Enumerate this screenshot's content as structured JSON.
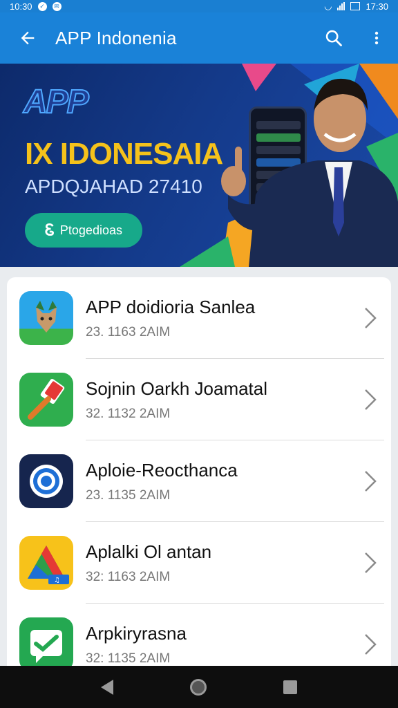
{
  "status_bar": {
    "time_left": "10:30",
    "time_right": "17:30"
  },
  "app_bar": {
    "title": "APP Indonenia",
    "back_icon": "arrow-left-icon",
    "search_icon": "search-icon",
    "menu_icon": "more-vert-icon"
  },
  "banner": {
    "logo": "APP",
    "headline": "IX IDONESAIA",
    "subline": "APDQJAHAD 27410",
    "cta_label": "Ptogedioas"
  },
  "apps": [
    {
      "title": "APP doidioria Sanlea",
      "subtitle": "23. 1163 2AIM",
      "icon": "fox-icon"
    },
    {
      "title": "Sojnin Oarkh Joamatal",
      "subtitle": "32. 1132 2AIM",
      "icon": "brush-icon"
    },
    {
      "title": "Aploie-Reocthanca",
      "subtitle": "23. 1135 2AIM",
      "icon": "target-icon"
    },
    {
      "title": "Aplalki Ol antan",
      "subtitle": "32: 1163 2AIM",
      "icon": "triangle-icon"
    },
    {
      "title": "Arpkiryrasna",
      "subtitle": "32: 1135 2AIM",
      "icon": "chat-check-icon"
    }
  ],
  "colors": {
    "app_bar": "#1a82d8",
    "banner_bg": "#143a8a",
    "headline": "#f5c21b",
    "cta": "#17a98a"
  }
}
